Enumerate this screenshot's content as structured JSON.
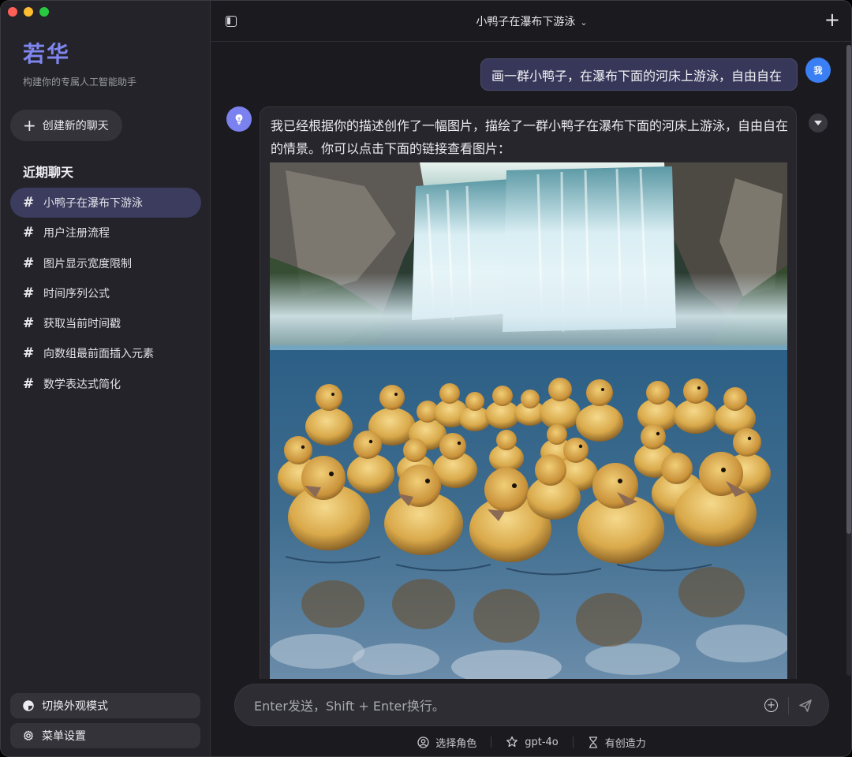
{
  "sidebar": {
    "app_name": "若华",
    "app_subtitle": "构建你的专属人工智能助手",
    "new_chat_label": "创建新的聊天",
    "recent_title": "近期聊天",
    "items": [
      {
        "label": "小鸭子在瀑布下游泳",
        "active": true
      },
      {
        "label": "用户注册流程",
        "active": false
      },
      {
        "label": "图片显示宽度限制",
        "active": false
      },
      {
        "label": "时间序列公式",
        "active": false
      },
      {
        "label": "获取当前时间戳",
        "active": false
      },
      {
        "label": "向数组最前面插入元素",
        "active": false
      },
      {
        "label": "数学表达式简化",
        "active": false
      }
    ],
    "toggle_theme_label": "切换外观模式",
    "settings_label": "菜单设置"
  },
  "header": {
    "title": "小鸭子在瀑布下游泳"
  },
  "messages": {
    "user": {
      "avatar_text": "我",
      "text": "画一群小鸭子，在瀑布下面的河床上游泳，自由自在"
    },
    "assistant": {
      "text": "我已经根据你的描述创作了一幅图片，描绘了一群小鸭子在瀑布下面的河床上游泳，自由自在的情景。你可以点击下面的链接查看图片："
    }
  },
  "composer": {
    "placeholder": "Enter发送，Shift + Enter换行。"
  },
  "footer_tools": {
    "role_label": "选择角色",
    "model_label": "gpt-4o",
    "creativity_label": "有创造力"
  },
  "colors": {
    "accent": "#7f86f0",
    "active_item": "#3b3c5e",
    "user_bubble": "#37375a",
    "user_avatar": "#3b7ff5"
  }
}
